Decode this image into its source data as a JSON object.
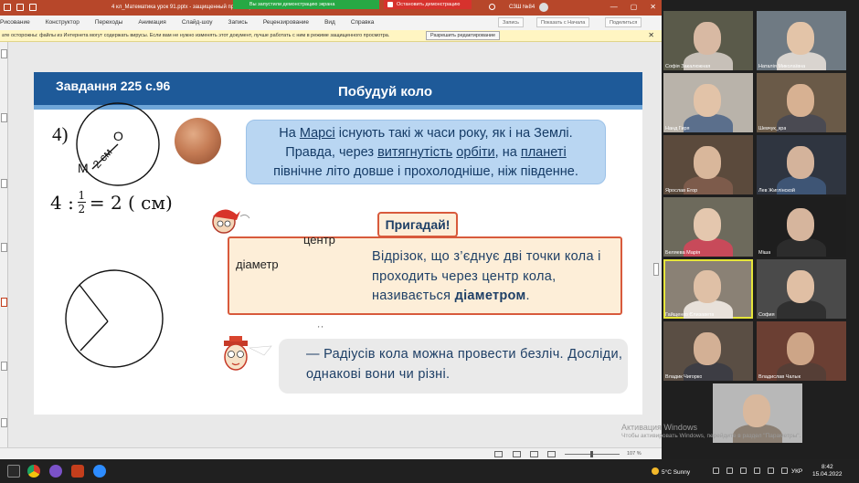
{
  "window": {
    "title": "4 кл_Математика урок 91.pptx  -  защищенный просмотр",
    "share_toast": "Вы запустили демонстрацию экрана",
    "stop_demo": "Остановить демонстрацию",
    "user": "СЗШ №84",
    "controls": [
      "—",
      "▢",
      "✕"
    ]
  },
  "ribbon": {
    "tabs": [
      "Рисование",
      "Конструктор",
      "Переходы",
      "Анимация",
      "Слайд-шоу",
      "Запись",
      "Рецензирование",
      "Вид",
      "Справка"
    ],
    "comments": "Запись",
    "present": "Показать с Начала",
    "share": "Поделиться"
  },
  "protected_view": {
    "message": "але интернета могут содержать вирусы. Если вам не нужно изменять этот документ, лучше работать с ним в режиме защищенного просмотра.",
    "message_prefix": "ате осторожны: файлы из Интернета могут содержать вирусы. Если вам не нужно изменять этот документ, лучше работать с ним в режиме защищенного просмотра.",
    "enable_button": "Разрешить редактирование",
    "close": "✕"
  },
  "slide": {
    "task": "Завдання  225 с.96",
    "topic": "Побудуй коло",
    "item_number": "4)",
    "circle_label_m": "М",
    "circle_label_o": "О",
    "circle_radius_label": "2 см",
    "formula": {
      "left": "4 :",
      "num": "1",
      "den": "2",
      "right": "= 2 ( см)"
    },
    "mars_text": {
      "l1a": "На ",
      "l1b": "Марсі",
      "l1c": " існують такі ж часи року, як і на Землі.",
      "l2a": "Правда, через ",
      "l2b": "витягнутість",
      "l2c": " ",
      "l2d": "орбіти",
      "l2e": ", на ",
      "l2f": "планеті",
      "l3": "північне літо довше і прохолодніше, ніж південне."
    },
    "remember": "Пригадай!",
    "label_center": "центр",
    "label_diameter": "діаметр",
    "definition": "Відрізок, що з’єднує дві точки кола і проходить через центр кола, називається ",
    "definition_term": "діаметром",
    "definition_end": ".",
    "radius_text": "— Радіусів кола можна провести безліч. Досліди, однакові вони чи різні."
  },
  "statusbar": {
    "zoom": "107 %"
  },
  "gallery": {
    "tiles": [
      {
        "name": "Софія Закалюжная",
        "skin": "#d8b9a3",
        "shirt": "#c7c0b8",
        "bg": "#5a5a4a"
      },
      {
        "name": "Наталія Миколаївна",
        "skin": "#e3c4a8",
        "shirt": "#d9d4cf",
        "bg": "#6f7a83"
      },
      {
        "name": "Нанд Гиря",
        "skin": "#e2c3a8",
        "shirt": "#5b6f8c",
        "bg": "#b9b3aa"
      },
      {
        "name": "Шевчук_кра",
        "skin": "#d7b192",
        "shirt": "#4a4a52",
        "bg": "#6a5a48"
      },
      {
        "name": "Ярослав Егор",
        "skin": "#d9b79b",
        "shirt": "#7d5b4b",
        "bg": "#5b4a3c"
      },
      {
        "name": "Лев Жиглінской",
        "skin": "#d4b39b",
        "shirt": "#3e5575",
        "bg": "#2f3540"
      },
      {
        "name": "Беляева Марія",
        "skin": "#e4c7ae",
        "shirt": "#c84a5a",
        "bg": "#6d6a5c"
      },
      {
        "name": "Міша",
        "skin": "#d6b59d",
        "shirt": "#2c2c2c",
        "bg": "#1e1e1e"
      },
      {
        "name": "Гайщенко Єлизавета",
        "skin": "#dfc0a6",
        "shirt": "#e8e1da",
        "bg": "#8a8175"
      },
      {
        "name": "София",
        "skin": "#e0bfa4",
        "shirt": "#303030",
        "bg": "#4a4a4a"
      },
      {
        "name": "Владик Чигорко",
        "skin": "#d3b095",
        "shirt": "#3d3d44",
        "bg": "#5a4e44"
      },
      {
        "name": "Владислав Чалык",
        "skin": "#cda587",
        "shirt": "#553e36",
        "bg": "#6b3f33"
      },
      {
        "name": "",
        "skin": "#d9b89d",
        "shirt": "#8b7f73",
        "bg": "#b8b8b8"
      }
    ]
  },
  "watermark": {
    "title": "Активация Windows",
    "subtitle": "Чтобы активировать Windows, перейдите в раздел \"Параметры\"."
  },
  "taskbar": {
    "weather": "5°C  Sunny",
    "lang": "УКР",
    "time": "8:42",
    "date": "15.04.2022"
  }
}
